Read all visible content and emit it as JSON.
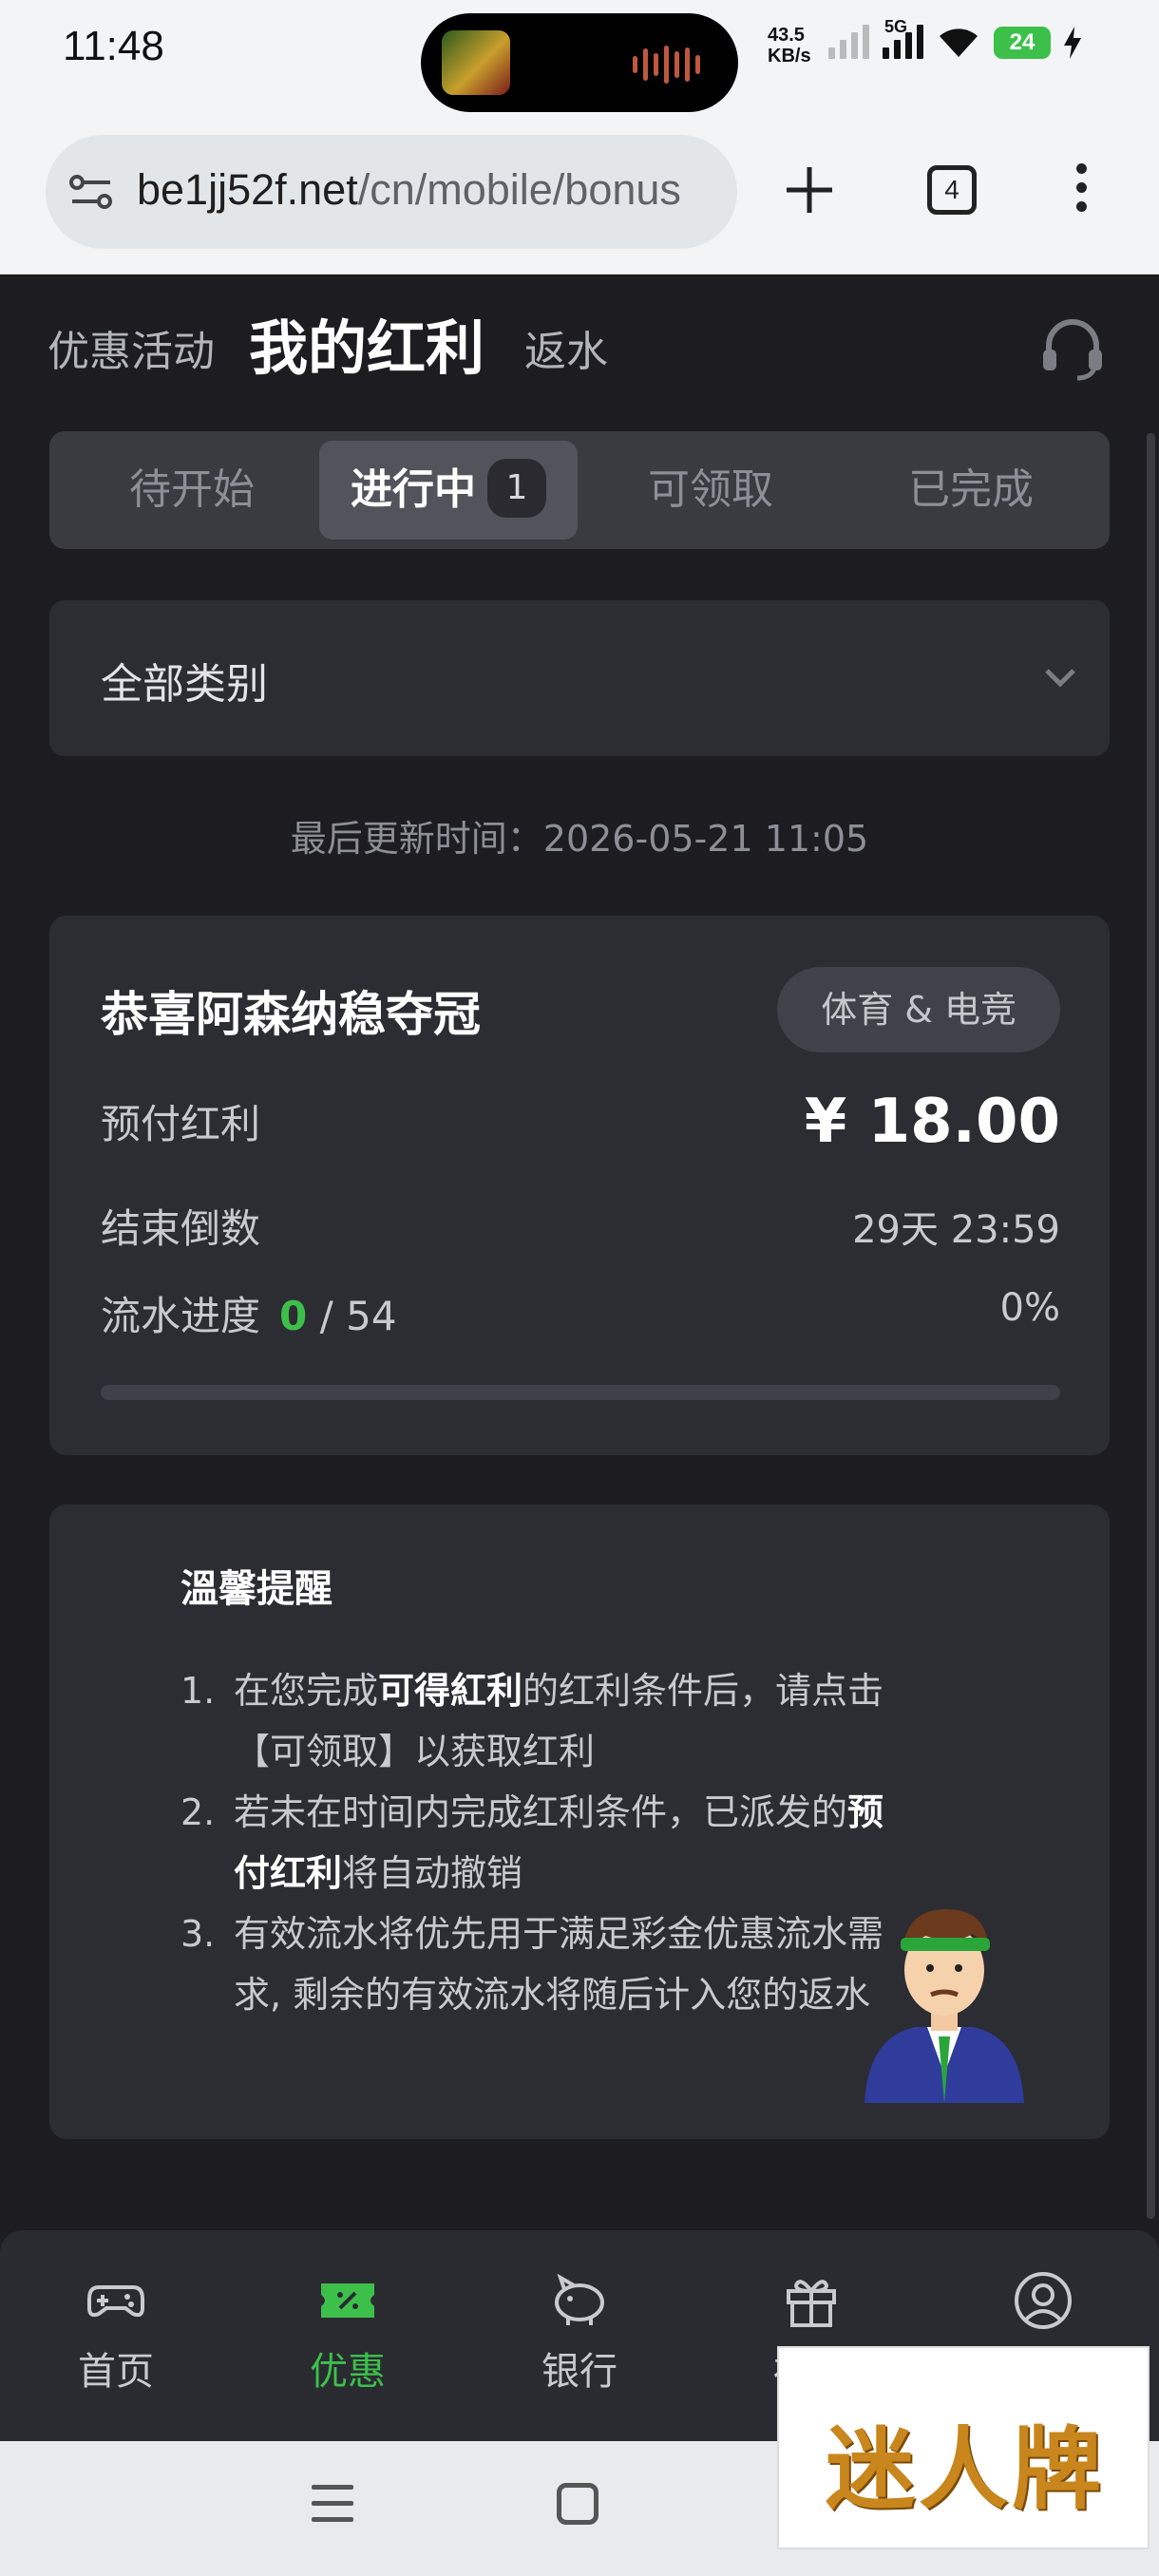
{
  "status_bar": {
    "time": "11:48",
    "net_speed_value": "43.5",
    "net_speed_unit": "KB/s",
    "network_type": "5G",
    "battery": "24"
  },
  "browser": {
    "url_host": "be1jj52f.net",
    "url_path": "/cn/mobile/bonus",
    "tab_count": "4"
  },
  "header": {
    "promo_link": "优惠活动",
    "active_title": "我的红利",
    "rebate_link": "返水"
  },
  "segments": [
    {
      "label": "待开始"
    },
    {
      "label": "进行中",
      "badge": "1",
      "active": true
    },
    {
      "label": "可领取"
    },
    {
      "label": "已完成"
    }
  ],
  "category_select": {
    "value": "全部类别"
  },
  "last_updated": "最后更新时间：2026-05-21 11:05",
  "bonus_card": {
    "title": "恭喜阿森纳稳夺冠",
    "tag": "体育 & 电竞",
    "prepaid_label": "预付红利",
    "prepaid_amount": "¥ 18.00",
    "countdown_label": "结束倒数",
    "countdown_value": "29天 23:59",
    "turnover_label": "流水进度",
    "turnover_current": "0",
    "turnover_total": "/ 54",
    "turnover_percent_text": "0%",
    "turnover_fraction": 0
  },
  "tips": {
    "title": "溫馨提醒",
    "items": [
      {
        "num": "1.",
        "pre": "在您完成",
        "bold": "可得紅利",
        "post": "的红利条件后，请点击【可领取】以获取红利"
      },
      {
        "num": "2.",
        "pre": "若未在时间内完成红利条件，已派发的",
        "bold": "预付红利",
        "post": "将自动撤销"
      },
      {
        "num": "3.",
        "pre": "有效流水将优先用于满足彩金优惠流水需求, 剩余的有效流水将随后计入您的返水",
        "bold": "",
        "post": ""
      }
    ]
  },
  "bottom_nav": [
    {
      "label": "首页",
      "icon": "gamepad-icon"
    },
    {
      "label": "优惠",
      "icon": "ticket-icon",
      "active": true
    },
    {
      "label": "银行",
      "icon": "piggy-bank-icon"
    },
    {
      "label": "福利",
      "icon": "gift-icon"
    },
    {
      "label": "",
      "icon": "user-icon"
    }
  ],
  "watermark": "迷人牌",
  "colors": {
    "accent_green": "#3cc04a",
    "page_bg": "#1c1c21",
    "card_bg": "#2c2c33"
  }
}
